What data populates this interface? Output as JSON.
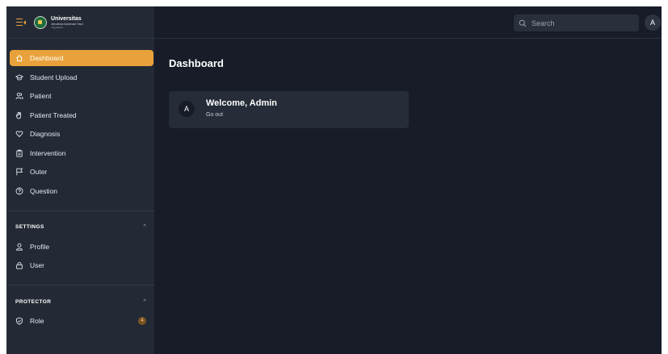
{
  "brand": {
    "name": "Universitas",
    "subtitle": "Jenderal Achmad Yani",
    "tagline": "Yogyakarta"
  },
  "colors": {
    "accent": "#e9a23b",
    "background": "#171c28",
    "sidebar": "#242a35",
    "card": "#262c38"
  },
  "sidebar": {
    "items": [
      {
        "label": "Dashboard",
        "icon": "home-icon",
        "active": true
      },
      {
        "label": "Student Upload",
        "icon": "graduation-cap-icon"
      },
      {
        "label": "Patient",
        "icon": "users-icon"
      },
      {
        "label": "Patient Treated",
        "icon": "hand-icon"
      },
      {
        "label": "Diagnosis",
        "icon": "heart-icon"
      },
      {
        "label": "Intervention",
        "icon": "clipboard-icon"
      },
      {
        "label": "Outer",
        "icon": "flag-icon"
      },
      {
        "label": "Question",
        "icon": "question-icon"
      }
    ],
    "settings": {
      "title": "SETTINGS",
      "chevron": "^",
      "items": [
        {
          "label": "Profile",
          "icon": "user-icon"
        },
        {
          "label": "User",
          "icon": "lock-icon"
        }
      ]
    },
    "protector": {
      "title": "PROTECTOR",
      "chevron": "^",
      "items": [
        {
          "label": "Role",
          "icon": "shield-icon",
          "badge": "4"
        }
      ]
    }
  },
  "topbar": {
    "search_placeholder": "Search",
    "avatar_initial": "A"
  },
  "main": {
    "title": "Dashboard",
    "welcome": {
      "avatar_initial": "A",
      "title": "Welcome, Admin",
      "link": "Go out"
    }
  }
}
